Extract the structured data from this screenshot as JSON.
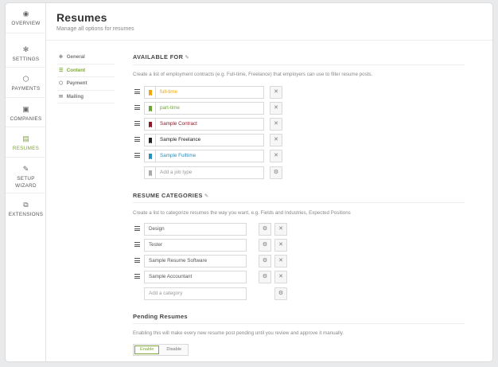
{
  "nav": [
    {
      "label": "OVERVIEW",
      "icon": "overview-icon",
      "glyph": "◉"
    },
    {
      "label": "SETTINGS",
      "icon": "gear-icon",
      "glyph": "✻"
    },
    {
      "label": "PAYMENTS",
      "icon": "tag-icon",
      "glyph": "⬡"
    },
    {
      "label": "COMPANIES",
      "icon": "briefcase-icon",
      "glyph": "▣"
    },
    {
      "label": "RESUMES",
      "icon": "resume-icon",
      "glyph": "▤"
    },
    {
      "label": "SETUP",
      "label2": "WIZARD",
      "icon": "wrench-icon",
      "glyph": "✎"
    },
    {
      "label": "EXTENSIONS",
      "icon": "extensions-icon",
      "glyph": "⧉"
    }
  ],
  "header": {
    "title": "Resumes",
    "subtitle": "Manage all options for resumes"
  },
  "subnav": [
    {
      "label": "General",
      "glyph": "✻"
    },
    {
      "label": "Content",
      "glyph": "☰"
    },
    {
      "label": "Payment",
      "glyph": "⬡"
    },
    {
      "label": "Mailing",
      "glyph": "✉"
    }
  ],
  "available": {
    "title": "AVAILABLE FOR",
    "description": "Create a list of employment contracts (e.g. Full-time, Freelance) that employers can use to filter resume posts.",
    "items": [
      {
        "label": "full-time",
        "color": "#f0a30a"
      },
      {
        "label": "part-time",
        "color": "#6aa536"
      },
      {
        "label": "Sample Contract",
        "color": "#8b1a2b"
      },
      {
        "label": "Sample Freelance",
        "color": "#222222"
      },
      {
        "label": "Sample Fulltime",
        "color": "#2a8fbd"
      }
    ],
    "add_placeholder": "Add a job type",
    "remove_glyph": "✕",
    "gear_glyph": "⚙"
  },
  "categories": {
    "title": "RESUME CATEGORIES",
    "description": "Create a list to categorize resumes the way you want, e.g. Fields and Industries, Expected Positions",
    "items": [
      {
        "label": "Design"
      },
      {
        "label": "Tester"
      },
      {
        "label": "Sample Resume Software"
      },
      {
        "label": "Sample Accountant"
      }
    ],
    "add_placeholder": "Add a category"
  },
  "pending": {
    "title": "Pending Resumes",
    "description": "Enabling this will make every new resume post pending until you review and approve it manually.",
    "enable": "Enable",
    "disable": "Disable"
  }
}
